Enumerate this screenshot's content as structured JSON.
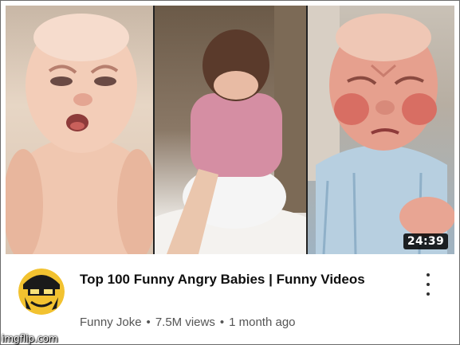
{
  "video": {
    "duration": "24:39",
    "title": "Top 100 Funny Angry Babies | Funny Videos",
    "channel": "Funny Joke",
    "views": "7.5M views",
    "age": "1 month ago",
    "separator": "•"
  },
  "avatar": {
    "icon": "cartoon-face-avatar",
    "colors": {
      "ring": "#1a1a1a",
      "face": "#f2c230"
    }
  },
  "menu": {
    "icon": "more-vert-icon"
  },
  "watermark": {
    "text": "imgflip.com"
  },
  "thumbnail": {
    "panels": [
      "baby-scowling-chubby",
      "baby-facing-wall",
      "newborn-angry-face"
    ]
  },
  "colors": {
    "title": "#0f0f0f",
    "subtitle": "#555555",
    "duration_bg": "#000000"
  }
}
